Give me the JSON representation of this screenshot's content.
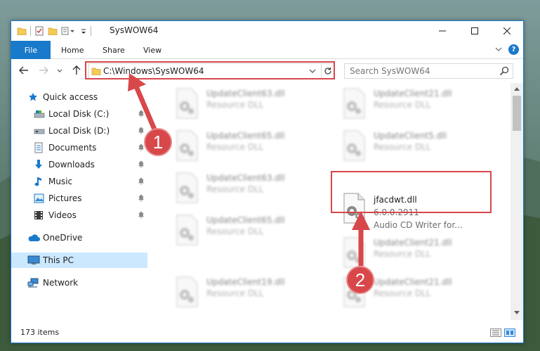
{
  "window": {
    "title": "SysWOW64",
    "accent_color": "#1979ca"
  },
  "ribbon": {
    "tabs": [
      {
        "label": "File"
      },
      {
        "label": "Home"
      },
      {
        "label": "Share"
      },
      {
        "label": "View"
      }
    ]
  },
  "address": {
    "path": "C:\\Windows\\SysWOW64"
  },
  "search": {
    "placeholder": "Search SysWOW64"
  },
  "navigation": {
    "items": [
      {
        "label": "Quick access",
        "icon": "star-icon",
        "pinned": false
      },
      {
        "label": "Local Disk (C:)",
        "icon": "drive-icon",
        "pinned": true
      },
      {
        "label": "Local Disk (D:)",
        "icon": "drive-icon",
        "pinned": true
      },
      {
        "label": "Documents",
        "icon": "documents-icon",
        "pinned": true
      },
      {
        "label": "Downloads",
        "icon": "download-icon",
        "pinned": true
      },
      {
        "label": "Music",
        "icon": "music-icon",
        "pinned": true
      },
      {
        "label": "Pictures",
        "icon": "pictures-icon",
        "pinned": true
      },
      {
        "label": "Videos",
        "icon": "videos-icon",
        "pinned": true
      },
      {
        "label": "OneDrive",
        "icon": "cloud-icon",
        "pinned": false
      },
      {
        "label": "This PC",
        "icon": "computer-icon",
        "pinned": false,
        "selected": true
      },
      {
        "label": "Network",
        "icon": "network-icon",
        "pinned": false
      }
    ]
  },
  "files": [
    {
      "name": "UpdateClient63.dll",
      "type": "Resource DLL",
      "blurred": true
    },
    {
      "name": "UpdateClient21.dll",
      "type": "Resource DLL",
      "blurred": true
    },
    {
      "name": "UpdateClient65.dll",
      "type": "Resource DLL",
      "blurred": true
    },
    {
      "name": "UpdateClient5.dll",
      "type": "Resource DLL",
      "blurred": true
    },
    {
      "name": "UpdateClient63.dll",
      "type": "Resource DLL",
      "blurred": true
    },
    {
      "name": "jfacdwt.dll",
      "version": "6.0.0.2911",
      "type": "Audio CD Writer for...",
      "blurred": false
    },
    {
      "name": "UpdateClient65.dll",
      "type": "Resource DLL",
      "blurred": true
    },
    {
      "name": "UpdateClient21.dll",
      "type": "Resource DLL",
      "blurred": true
    },
    {
      "name": "UpdateClient19.dll",
      "type": "Resource DLL",
      "blurred": true
    },
    {
      "name": "UpdateClient21.dll",
      "type": "Resource DLL",
      "blurred": true
    }
  ],
  "status": {
    "item_count": "173 items"
  },
  "annotations": {
    "step1": "1",
    "step2": "2",
    "color": "#d8474a"
  }
}
